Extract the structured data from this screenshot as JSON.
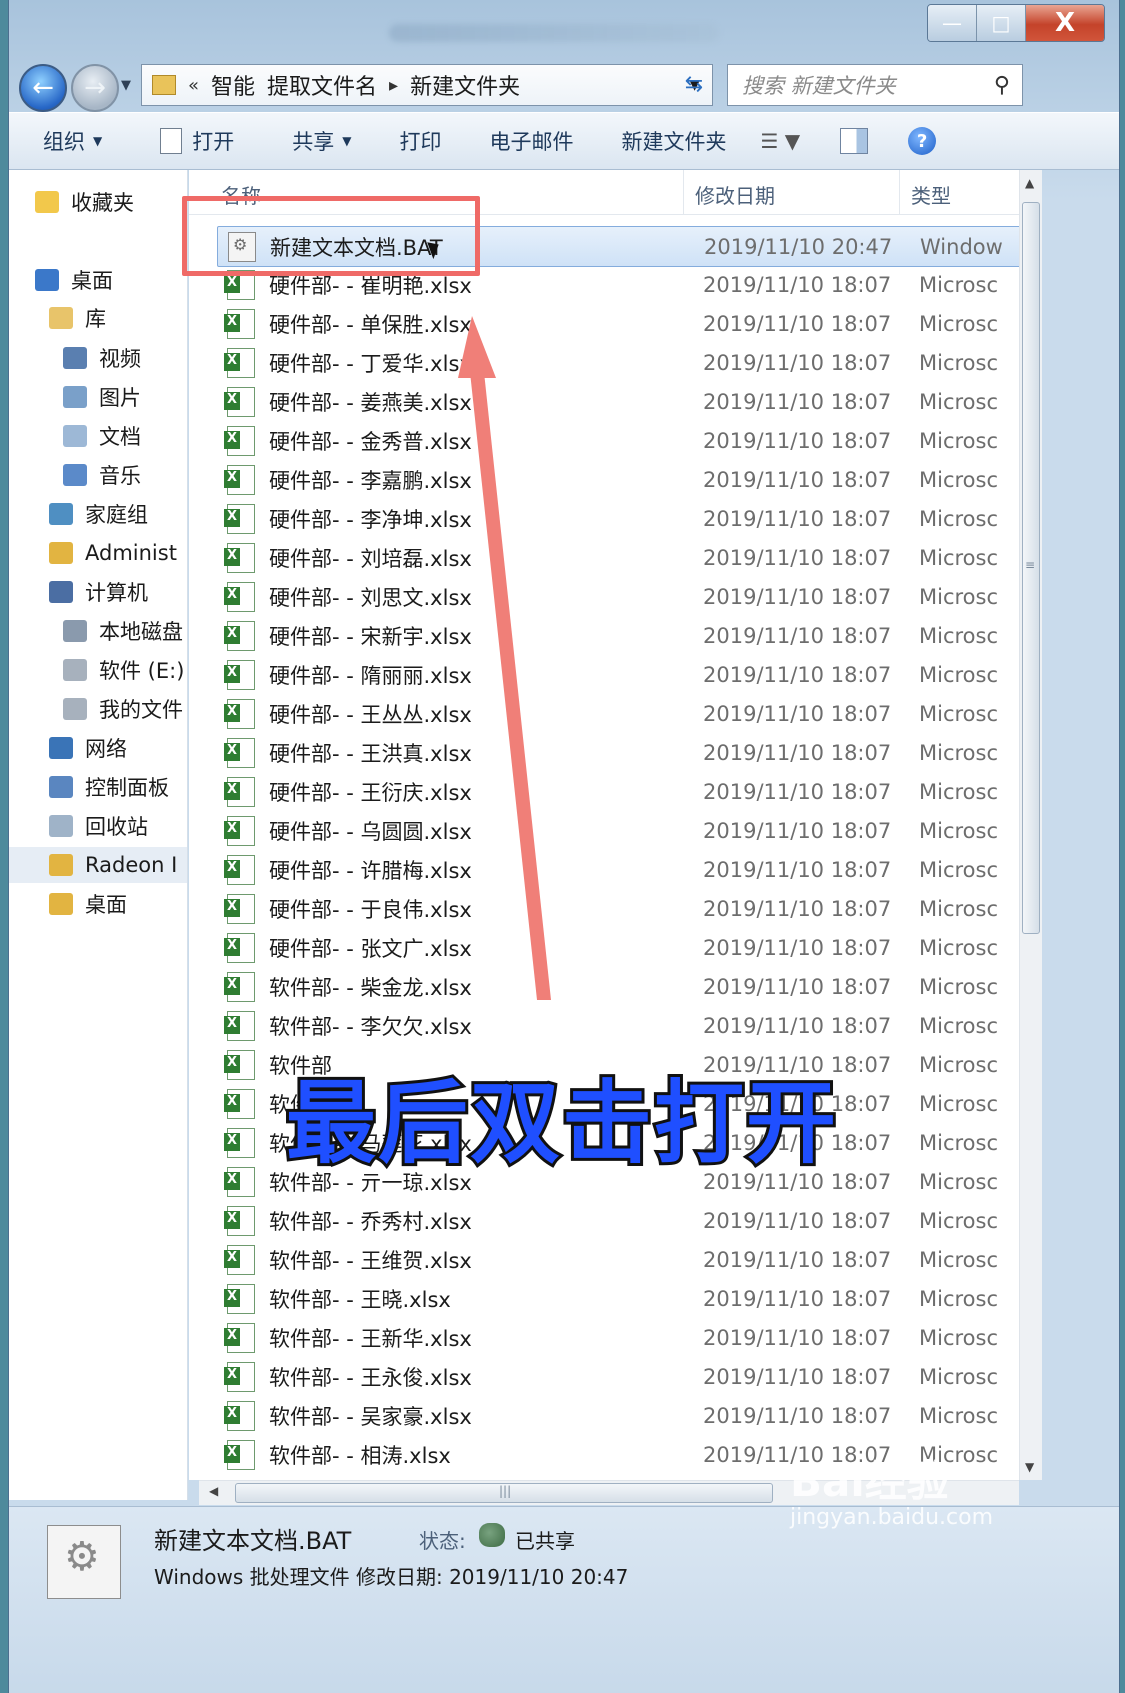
{
  "window": {
    "minimize": "—",
    "maximize": "□",
    "close": "X"
  },
  "address": {
    "chevrons": "«",
    "crumbs": [
      "智能",
      "提取文件名",
      "新建文件夹"
    ],
    "separator": "▸",
    "search_placeholder": "搜索 新建文件夹"
  },
  "toolbar": {
    "organize": "组织",
    "open": "打开",
    "share": "共享",
    "print": "打印",
    "email": "电子邮件",
    "new_folder": "新建文件夹"
  },
  "nav": [
    {
      "label": "收藏夹",
      "color": "#f2c84b"
    },
    {
      "label": "桌面",
      "color": "#3b78c9"
    },
    {
      "label": "库",
      "color": "#e8c46a"
    },
    {
      "label": "视频",
      "color": "#5a7fb0"
    },
    {
      "label": "图片",
      "color": "#7aa0c9"
    },
    {
      "label": "文档",
      "color": "#9db8d6"
    },
    {
      "label": "音乐",
      "color": "#5b8ac9"
    },
    {
      "label": "家庭组",
      "color": "#4f8fc2"
    },
    {
      "label": "Administ",
      "color": "#e2b441"
    },
    {
      "label": "计算机",
      "color": "#4b6ea3"
    },
    {
      "label": "本地磁盘",
      "color": "#8a9aad"
    },
    {
      "label": "软件 (E:)",
      "color": "#a7b1bd"
    },
    {
      "label": "我的文件",
      "color": "#a7b1bd"
    },
    {
      "label": "网络",
      "color": "#3a74b7"
    },
    {
      "label": "控制面板",
      "color": "#5a86c0"
    },
    {
      "label": "回收站",
      "color": "#9fb3c8"
    },
    {
      "label": "Radeon I",
      "color": "#e2b441"
    },
    {
      "label": "桌面",
      "color": "#e2b441"
    }
  ],
  "columns": {
    "name": "名称",
    "date": "修改日期",
    "type": "类型"
  },
  "files": [
    {
      "name": "新建文本文档.BAT",
      "date": "2019/11/10 20:47",
      "type": "Window",
      "kind": "bat"
    },
    {
      "name": "硬件部- - 崔明艳.xlsx",
      "date": "2019/11/10 18:07",
      "type": "Microsc",
      "kind": "xlsx"
    },
    {
      "name": "硬件部- - 单保胜.xlsx",
      "date": "2019/11/10 18:07",
      "type": "Microsc",
      "kind": "xlsx"
    },
    {
      "name": "硬件部- - 丁爱华.xlsx",
      "date": "2019/11/10 18:07",
      "type": "Microsc",
      "kind": "xlsx"
    },
    {
      "name": "硬件部- - 姜燕美.xlsx",
      "date": "2019/11/10 18:07",
      "type": "Microsc",
      "kind": "xlsx"
    },
    {
      "name": "硬件部- - 金秀普.xlsx",
      "date": "2019/11/10 18:07",
      "type": "Microsc",
      "kind": "xlsx"
    },
    {
      "name": "硬件部- - 李嘉鹏.xlsx",
      "date": "2019/11/10 18:07",
      "type": "Microsc",
      "kind": "xlsx"
    },
    {
      "name": "硬件部- - 李净坤.xlsx",
      "date": "2019/11/10 18:07",
      "type": "Microsc",
      "kind": "xlsx"
    },
    {
      "name": "硬件部- - 刘培磊.xlsx",
      "date": "2019/11/10 18:07",
      "type": "Microsc",
      "kind": "xlsx"
    },
    {
      "name": "硬件部- - 刘思文.xlsx",
      "date": "2019/11/10 18:07",
      "type": "Microsc",
      "kind": "xlsx"
    },
    {
      "name": "硬件部- - 宋新宇.xlsx",
      "date": "2019/11/10 18:07",
      "type": "Microsc",
      "kind": "xlsx"
    },
    {
      "name": "硬件部- - 隋丽丽.xlsx",
      "date": "2019/11/10 18:07",
      "type": "Microsc",
      "kind": "xlsx"
    },
    {
      "name": "硬件部- - 王丛丛.xlsx",
      "date": "2019/11/10 18:07",
      "type": "Microsc",
      "kind": "xlsx"
    },
    {
      "name": "硬件部- - 王洪真.xlsx",
      "date": "2019/11/10 18:07",
      "type": "Microsc",
      "kind": "xlsx"
    },
    {
      "name": "硬件部- - 王衍庆.xlsx",
      "date": "2019/11/10 18:07",
      "type": "Microsc",
      "kind": "xlsx"
    },
    {
      "name": "硬件部- - 乌圆圆.xlsx",
      "date": "2019/11/10 18:07",
      "type": "Microsc",
      "kind": "xlsx"
    },
    {
      "name": "硬件部- - 许腊梅.xlsx",
      "date": "2019/11/10 18:07",
      "type": "Microsc",
      "kind": "xlsx"
    },
    {
      "name": "硬件部- - 于良伟.xlsx",
      "date": "2019/11/10 18:07",
      "type": "Microsc",
      "kind": "xlsx"
    },
    {
      "name": "硬件部- - 张文广.xlsx",
      "date": "2019/11/10 18:07",
      "type": "Microsc",
      "kind": "xlsx"
    },
    {
      "name": "软件部- - 柴金龙.xlsx",
      "date": "2019/11/10 18:07",
      "type": "Microsc",
      "kind": "xlsx"
    },
    {
      "name": "软件部- - 李欠欠.xlsx",
      "date": "2019/11/10 18:07",
      "type": "Microsc",
      "kind": "xlsx"
    },
    {
      "name": "软件部",
      "date": "2019/11/10 18:07",
      "type": "Microsc",
      "kind": "xlsx"
    },
    {
      "name": "软件部",
      "date": "2019/11/10 18:07",
      "type": "Microsc",
      "kind": "xlsx"
    },
    {
      "name": "软件部- - 马莲花.xlsx",
      "date": "2019/11/10 18:07",
      "type": "Microsc",
      "kind": "xlsx"
    },
    {
      "name": "软件部- - 亓一琼.xlsx",
      "date": "2019/11/10 18:07",
      "type": "Microsc",
      "kind": "xlsx"
    },
    {
      "name": "软件部- - 乔秀村.xlsx",
      "date": "2019/11/10 18:07",
      "type": "Microsc",
      "kind": "xlsx"
    },
    {
      "name": "软件部- - 王维贺.xlsx",
      "date": "2019/11/10 18:07",
      "type": "Microsc",
      "kind": "xlsx"
    },
    {
      "name": "软件部- - 王晓.xlsx",
      "date": "2019/11/10 18:07",
      "type": "Microsc",
      "kind": "xlsx"
    },
    {
      "name": "软件部- - 王新华.xlsx",
      "date": "2019/11/10 18:07",
      "type": "Microsc",
      "kind": "xlsx"
    },
    {
      "name": "软件部- - 王永俊.xlsx",
      "date": "2019/11/10 18:07",
      "type": "Microsc",
      "kind": "xlsx"
    },
    {
      "name": "软件部- - 吴家豪.xlsx",
      "date": "2019/11/10 18:07",
      "type": "Microsc",
      "kind": "xlsx"
    },
    {
      "name": "软件部- - 相涛.xlsx",
      "date": "2019/11/10 18:07",
      "type": "Microsc",
      "kind": "xlsx"
    }
  ],
  "details": {
    "name": "新建文本文档.BAT",
    "state_label": "状态:",
    "state_value": "已共享",
    "line2": "Windows 批处理文件  修改日期: 2019/11/10 20:47"
  },
  "overlay": {
    "caption": "最后双击打开",
    "highlight_color": "#ef6a67",
    "arrow_color": "#f07f78"
  },
  "watermark": {
    "brand": "Bai经验",
    "url": "jingyan.baidu.com"
  }
}
